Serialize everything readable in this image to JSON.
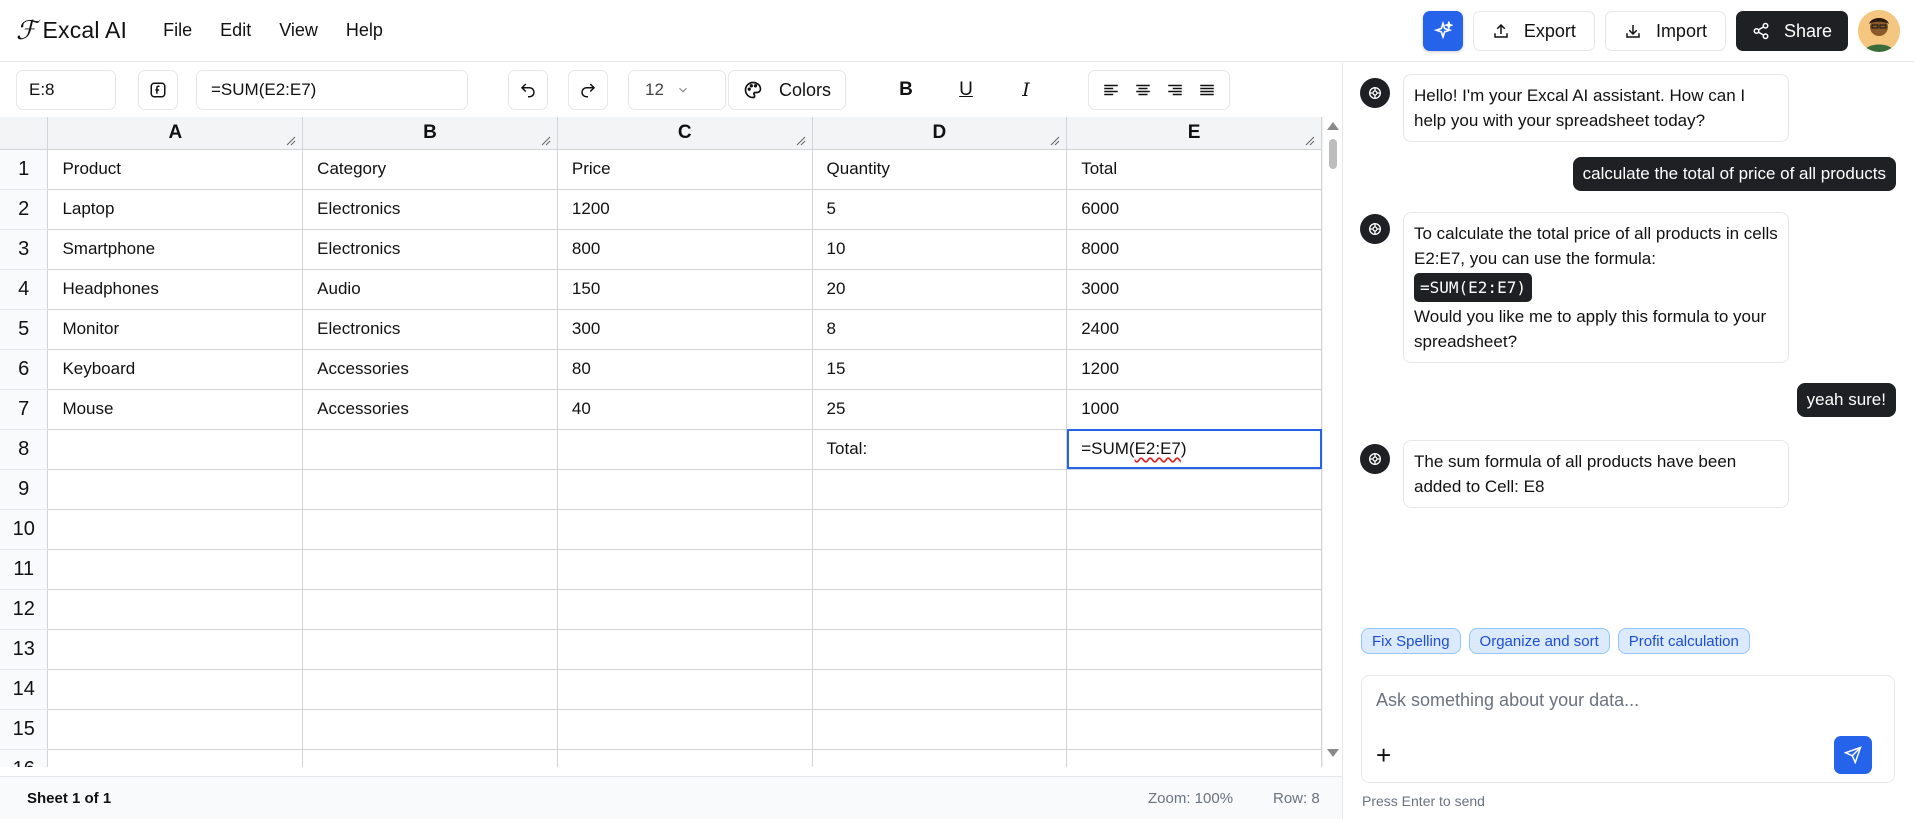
{
  "app": {
    "logo_mark": "ℱ",
    "title": "Excal AI"
  },
  "menu": [
    "File",
    "Edit",
    "View",
    "Help"
  ],
  "actions": {
    "export": "Export",
    "import": "Import",
    "share": "Share"
  },
  "toolbar": {
    "cell_ref": "E:8",
    "formula": "=SUM(E2:E7)",
    "font_size": "12",
    "colors_label": "Colors",
    "bold": "B",
    "underline": "U",
    "italic": "I"
  },
  "grid": {
    "columns": [
      "A",
      "B",
      "C",
      "D",
      "E"
    ],
    "rows": [
      {
        "n": "1",
        "cells": [
          "Product",
          "Category",
          "Price",
          "Quantity",
          "Total"
        ]
      },
      {
        "n": "2",
        "cells": [
          "Laptop",
          "Electronics",
          "1200",
          "5",
          "6000"
        ]
      },
      {
        "n": "3",
        "cells": [
          "Smartphone",
          "Electronics",
          "800",
          "10",
          "8000"
        ]
      },
      {
        "n": "4",
        "cells": [
          "Headphones",
          "Audio",
          "150",
          "20",
          "3000"
        ]
      },
      {
        "n": "5",
        "cells": [
          "Monitor",
          "Electronics",
          "300",
          "8",
          "2400"
        ]
      },
      {
        "n": "6",
        "cells": [
          "Keyboard",
          "Accessories",
          "80",
          "15",
          "1200"
        ]
      },
      {
        "n": "7",
        "cells": [
          "Mouse",
          "Accessories",
          "40",
          "25",
          "1000"
        ]
      },
      {
        "n": "8",
        "cells": [
          "",
          "",
          "",
          "Total:",
          "=SUM(E2:E7)"
        ]
      },
      {
        "n": "9",
        "cells": [
          "",
          "",
          "",
          "",
          ""
        ]
      },
      {
        "n": "10",
        "cells": [
          "",
          "",
          "",
          "",
          ""
        ]
      },
      {
        "n": "11",
        "cells": [
          "",
          "",
          "",
          "",
          ""
        ]
      },
      {
        "n": "12",
        "cells": [
          "",
          "",
          "",
          "",
          ""
        ]
      },
      {
        "n": "13",
        "cells": [
          "",
          "",
          "",
          "",
          ""
        ]
      },
      {
        "n": "14",
        "cells": [
          "",
          "",
          "",
          "",
          ""
        ]
      },
      {
        "n": "15",
        "cells": [
          "",
          "",
          "",
          "",
          ""
        ]
      },
      {
        "n": "16",
        "cells": [
          "",
          "",
          "",
          "",
          ""
        ]
      }
    ]
  },
  "status": {
    "sheet": "Sheet 1 of 1",
    "zoom": "Zoom: 100%",
    "row": "Row: 8"
  },
  "chat": {
    "m1": "Hello! I'm your Excal AI assistant. How can I help you with your spreadsheet today?",
    "u1": "calculate the total of price of all products",
    "m2_a": "To calculate the total price of all products in cells E2:E7, you can use the formula:",
    "m2_code": "=SUM(E2:E7)",
    "m2_b": "Would you like me to apply this formula to your spreadsheet?",
    "u2": "yeah sure!",
    "m3": "The sum formula of all products have been added to Cell: E8",
    "chips": [
      "Fix Spelling",
      "Organize and sort",
      "Profit calculation"
    ],
    "placeholder": "Ask something about your data...",
    "hint": "Press Enter to send"
  },
  "colors": {
    "accent": "#2563eb",
    "dark": "#1f2023",
    "chip_bg": "#dbeafe"
  },
  "icons": [
    "sparkle-icon",
    "upload-icon",
    "download-icon",
    "share-icon",
    "function-icon",
    "undo-icon",
    "redo-icon",
    "palette-icon",
    "bot-icon",
    "send-icon"
  ]
}
